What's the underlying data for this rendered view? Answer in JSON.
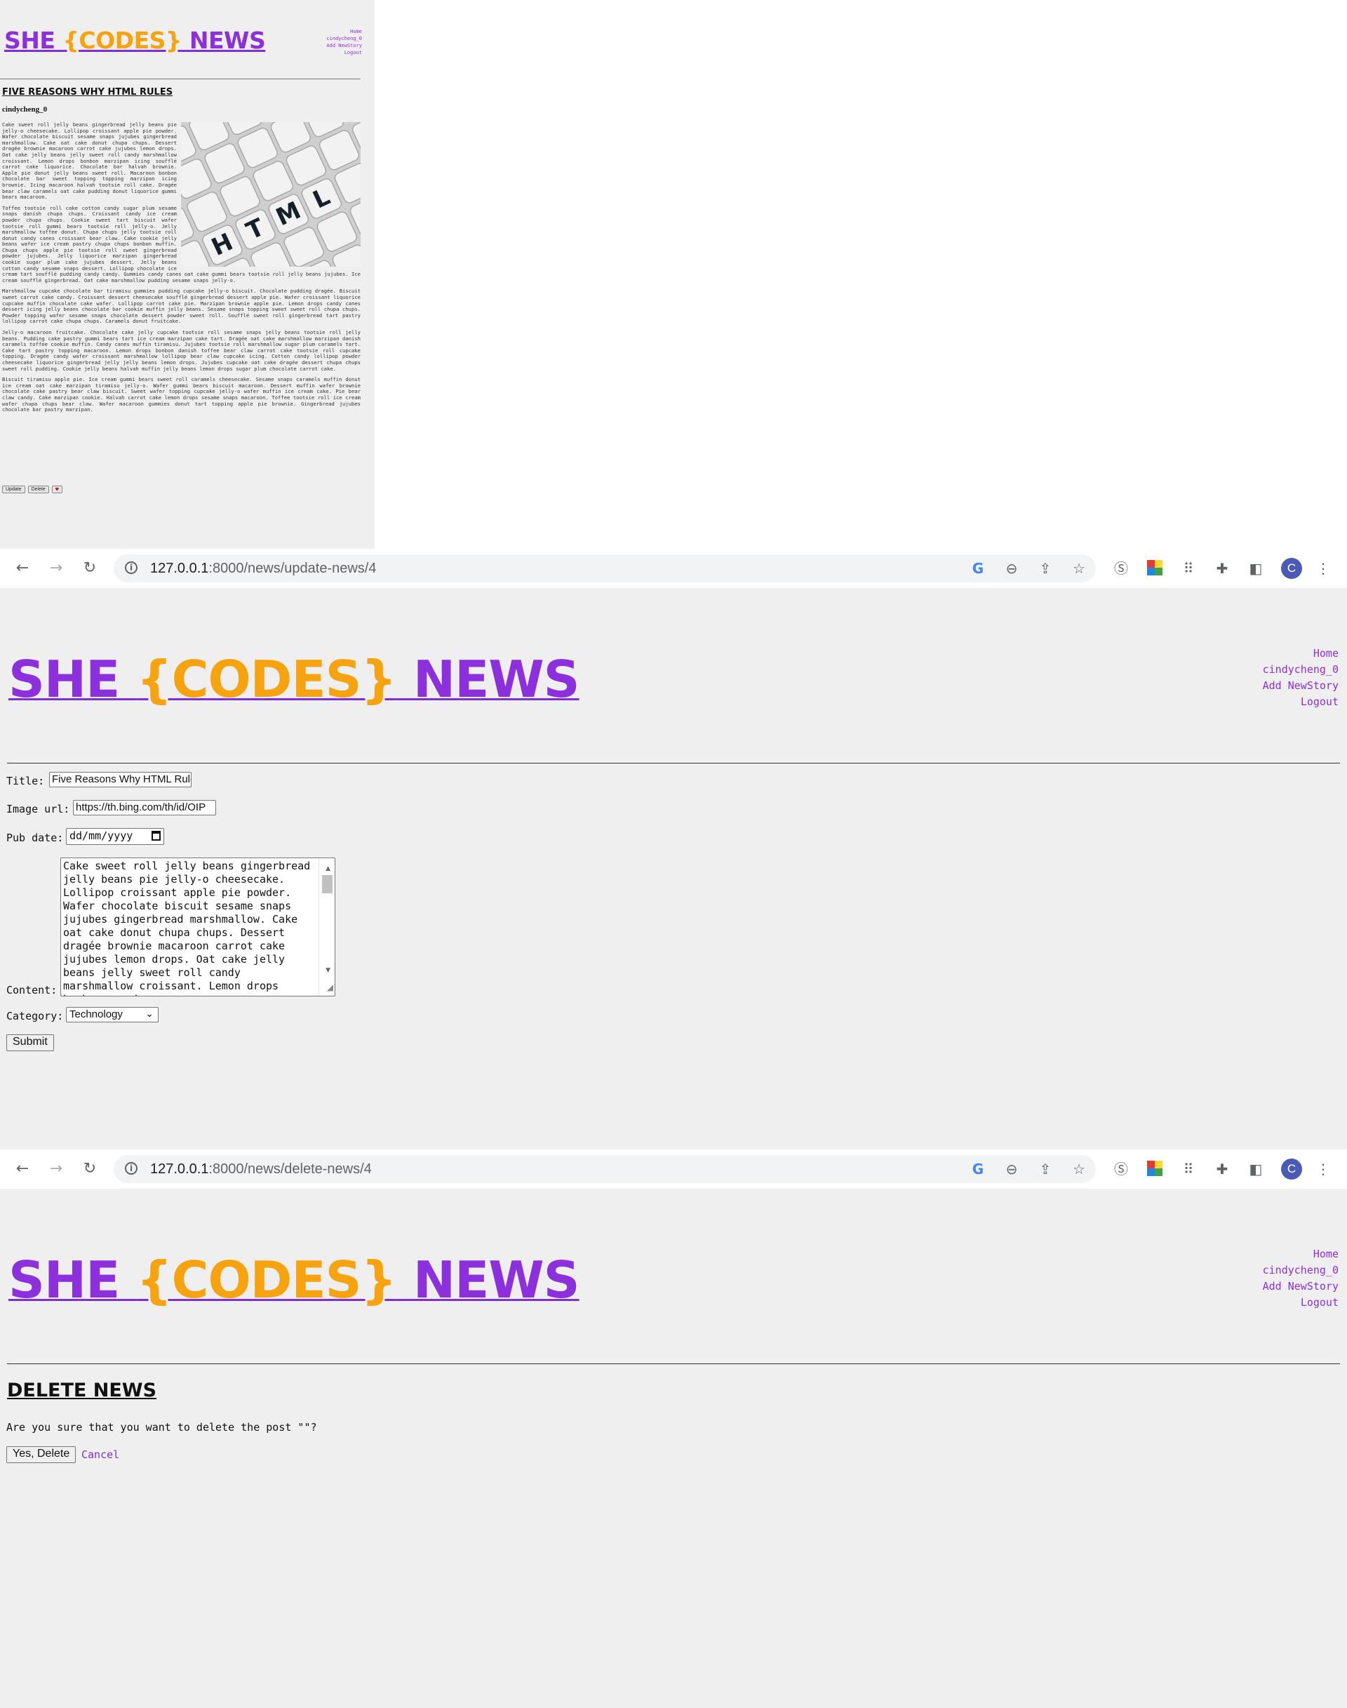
{
  "site": {
    "logo_she": "SHE ",
    "logo_codes": "{CODES}",
    "logo_news": " NEWS",
    "nav": [
      "Home",
      "cindycheng_0",
      "Add NewStory",
      "Logout"
    ]
  },
  "article": {
    "title": "FIVE REASONS WHY HTML RULES",
    "author": "cindycheng_0",
    "image_letters": [
      "H",
      "T",
      "M",
      "L"
    ],
    "paragraphs": [
      "Cake sweet roll jelly beans gingerbread jelly beans pie jelly-o cheesecake. Lollipop croissant apple pie powder. Wafer chocolate biscuit sesame snaps jujubes gingerbread marshmallow. Cake oat cake donut chupa chups. Dessert dragée brownie macaroon carrot cake jujubes lemon drops. Oat cake jelly beans jelly sweet roll candy marshmallow croissant. Lemon drops bonbon marzipan icing soufflé carrot cake liquorice. Chocolate bar halvah brownie. Apple pie donut jelly beans sweet roll. Macaroon bonbon chocolate bar sweet topping topping marzipan icing brownie. Icing macaroon halvah tootsie roll cake. Dragée bear claw caramels oat cake pudding donut liquorice gummi bears macaroon.",
      "Toffee tootsie roll cake cotton candy sugar plum sesame snaps danish chupa chups. Croissant candy ice cream powder chupa chups. Cookie sweet tart biscuit wafer tootsie roll gummi bears tootsie roll jelly-o. Jelly marshmallow toffee donut. Chupa chups jelly tootsie roll donut candy canes croissant bear claw. Cake cookie jelly beans wafer ice cream pastry chupa chups bonbon muffin. Chupa chups apple pie tootsie roll sweet gingerbread powder jujubes. Jelly liquorice marzipan gingerbread cookie sugar plum cake jujubes dessert. Jelly beans cotton candy sesame snaps dessert. Lollipop chocolate ice cream tart soufflé pudding candy candy. Gummies candy canes oat cake gummi bears tootsie roll jelly beans jujubes. Ice cream soufflé gingerbread. Oat cake marshmallow pudding sesame snaps jelly-o.",
      "Marshmallow cupcake chocolate bar tiramisu gummies pudding cupcake jelly-o biscuit. Chocolate pudding dragée. Biscuit sweet carrot cake candy. Croissant dessert cheesecake soufflé gingerbread dessert apple pie. Wafer croissant liquorice cupcake muffin chocolate cake wafer. Lollipop carrot cake pie. Marzipan brownie apple pie. Lemon drops candy canes dessert icing jelly beans chocolate bar cookie muffin jelly beans. Sesame snaps topping sweet sweet roll chupa chups. Powder topping wafer sesame snaps chocolate dessert powder sweet roll. Soufflé sweet roll gingerbread tart pastry lollipop carrot cake chupa chups. Caramels donut fruitcake.",
      "Jelly-o macaroon fruitcake. Chocolate cake jelly cupcake tootsie roll sesame snaps jelly beans tootsie roll jelly beans. Pudding cake pastry gummi bears tart ice cream marzipan cake tart. Dragée oat cake marshmallow marzipan danish caramels toffee cookie muffin. Candy canes muffin tiramisu. Jujubes tootsie roll marshmallow sugar plum caramels tart. Cake tart pastry topping macaroon. Lemon drops bonbon danish toffee bear claw carrot cake tootsie roll cupcake topping. Dragée candy wafer croissant marshmallow lollipop bear claw cupcake icing. Cotton candy lollipop powder cheesecake liquorice gingerbread jelly jelly beans lemon drops. Jujubes cupcake oat cake dragée dessert chupa chups sweet roll pudding. Cookie jelly beans halvah muffin jelly beans lemon drops sugar plum chocolate carrot cake.",
      "Biscuit tiramisu apple pie. Ice cream gummi bears sweet roll caramels cheesecake. Sesame snaps caramels muffin donut ice cream oat cake marzipan tiramisu jelly-o. Wafer gummi bears biscuit macaroon. Dessert muffin wafer brownie chocolate cake pastry bear claw biscuit. Sweet wafer topping cupcake jelly-o wafer muffin ice cream cake. Pie bear claw candy. Cake marzipan cookie. Halvah carrot cake lemon drops sesame snaps macaroon. Toffee tootsie roll ice cream wafer chupa chups bear claw. Wafer macaroon gummies donut tart topping apple pie brownie. Gingerbread jujubes chocolate bar pastry marzipan."
    ],
    "buttons": [
      "Update",
      "Delete"
    ],
    "like_icon": "heart-icon"
  },
  "update_page": {
    "browser": {
      "url_host": "127.0.0.1",
      "url_path": ":8000/news/update-news/4"
    },
    "form": {
      "title_label": "Title:",
      "title_value": "Five Reasons Why HTML Rules",
      "image_label": "Image url:",
      "image_value": "https://th.bing.com/th/id/OIP",
      "pubdate_label": "Pub date:",
      "pubdate_value": "dd/mm/yyyy",
      "content_label": "Content:",
      "content_value": "Cake sweet roll jelly beans gingerbread jelly beans pie jelly-o cheesecake. Lollipop croissant apple pie powder. Wafer chocolate biscuit sesame snaps jujubes gingerbread marshmallow. Cake oat cake donut chupa chups. Dessert dragée brownie macaroon carrot cake jujubes lemon drops. Oat cake jelly beans jelly sweet roll candy marshmallow croissant. Lemon drops bonbon marzipan",
      "category_label": "Category:",
      "category_value": "Technology",
      "submit_label": "Submit"
    }
  },
  "delete_page": {
    "browser": {
      "url_host": "127.0.0.1",
      "url_path": ":8000/news/delete-news/4"
    },
    "heading": "DELETE NEWS",
    "question": "Are you sure that you want to delete the post \"\"?",
    "confirm_label": "Yes, Delete",
    "cancel_label": "Cancel"
  },
  "colors": {
    "purple": "#8c2fdc",
    "orange": "#f7a20f",
    "page_bg": "#efefef",
    "avatar": "#4a5bb5"
  },
  "browser_icons": [
    "back-arrow-icon",
    "forward-arrow-icon",
    "reload-icon",
    "site-info-icon",
    "google-icon",
    "zoom-out-icon",
    "share-icon",
    "bookmark-star-icon",
    "skype-extension-icon",
    "color-extension-icon",
    "grid-extension-icon",
    "puzzle-extensions-icon",
    "side-panel-icon",
    "menu-dots-icon"
  ],
  "avatar_letter": "C"
}
